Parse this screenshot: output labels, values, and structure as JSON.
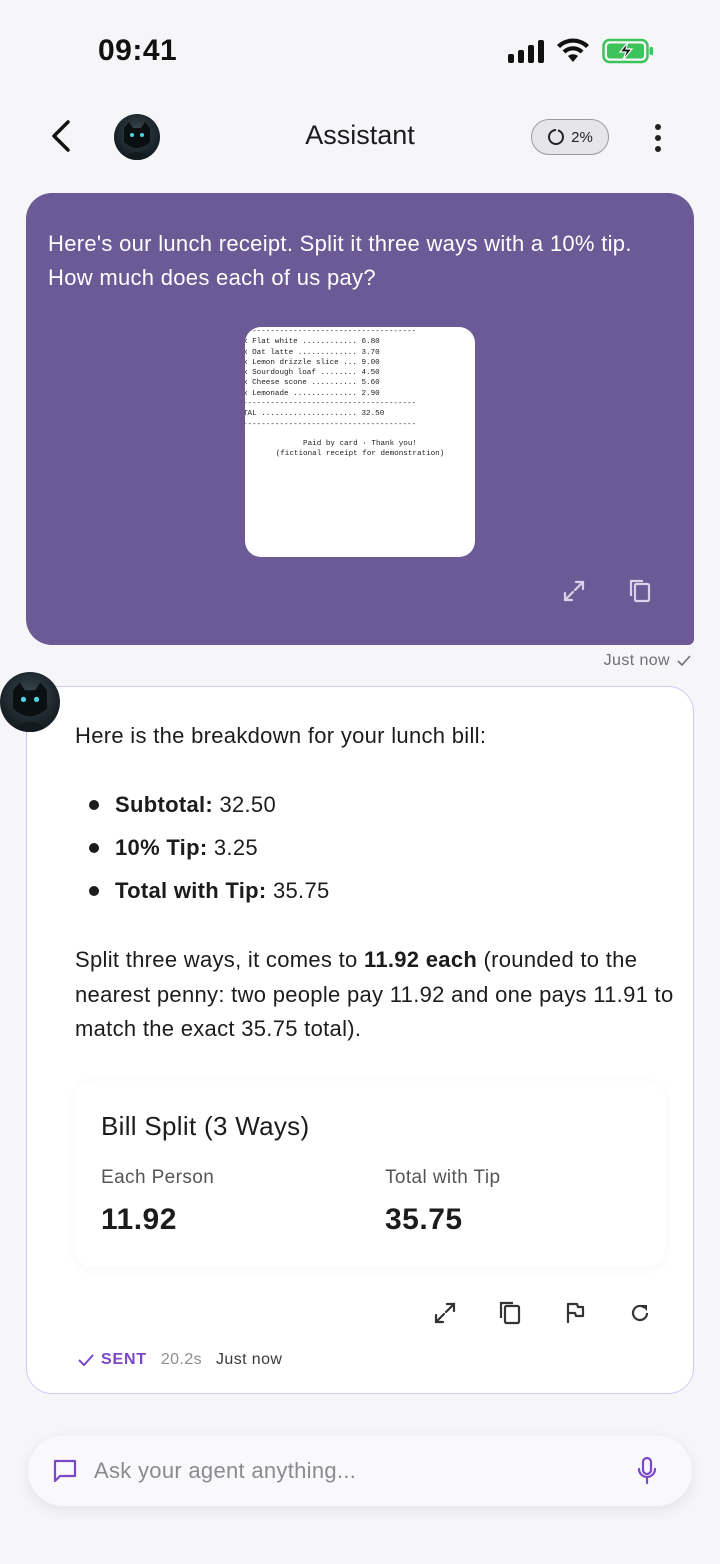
{
  "status_bar": {
    "time": "09:41"
  },
  "header": {
    "title": "Assistant",
    "usage": "2%"
  },
  "user_message": {
    "text": "Here's our lunch receipt. Split it three ways with a 10% tip. How much does each of us pay?",
    "receipt_lines": [
      "--------------------------------------",
      "x Flat white ............ 6.80",
      "x Oat latte ............. 3.70",
      "x Lemon drizzle slice ... 9.00",
      "x Sourdough loaf ........ 4.50",
      "x Cheese scone .......... 5.60",
      "x Lemonade .............. 2.90",
      "--------------------------------------",
      "TAL ..................... 32.50",
      "--------------------------------------"
    ],
    "receipt_footer": [
      "Paid by card · Thank you!",
      "(fictional receipt for demonstration)"
    ],
    "meta": "Just now"
  },
  "assistant_message": {
    "intro": "Here is the breakdown for your lunch bill:",
    "items": [
      {
        "label": "Subtotal:",
        "value": "32.50"
      },
      {
        "label": "10% Tip:",
        "value": "3.25"
      },
      {
        "label": "Total with Tip:",
        "value": "35.75"
      }
    ],
    "para_before": "Split three ways, it comes to ",
    "para_bold": "11.92 each",
    "para_after": " (rounded to the nearest penny: two people pay 11.92 and one pays 11.91 to match the exact 35.75 total).",
    "card": {
      "title": "Bill Split (3 Ways)",
      "col1_label": "Each Person",
      "col1_value": "11.92",
      "col2_label": "Total with Tip",
      "col2_value": "35.75"
    },
    "status": "SENT",
    "duration": "20.2s",
    "time": "Just now"
  },
  "input": {
    "placeholder": "Ask your agent anything..."
  },
  "colors": {
    "accent": "#7b46c7",
    "user_bubble": "#6b5a96",
    "card_border": "#d6c8f0"
  }
}
